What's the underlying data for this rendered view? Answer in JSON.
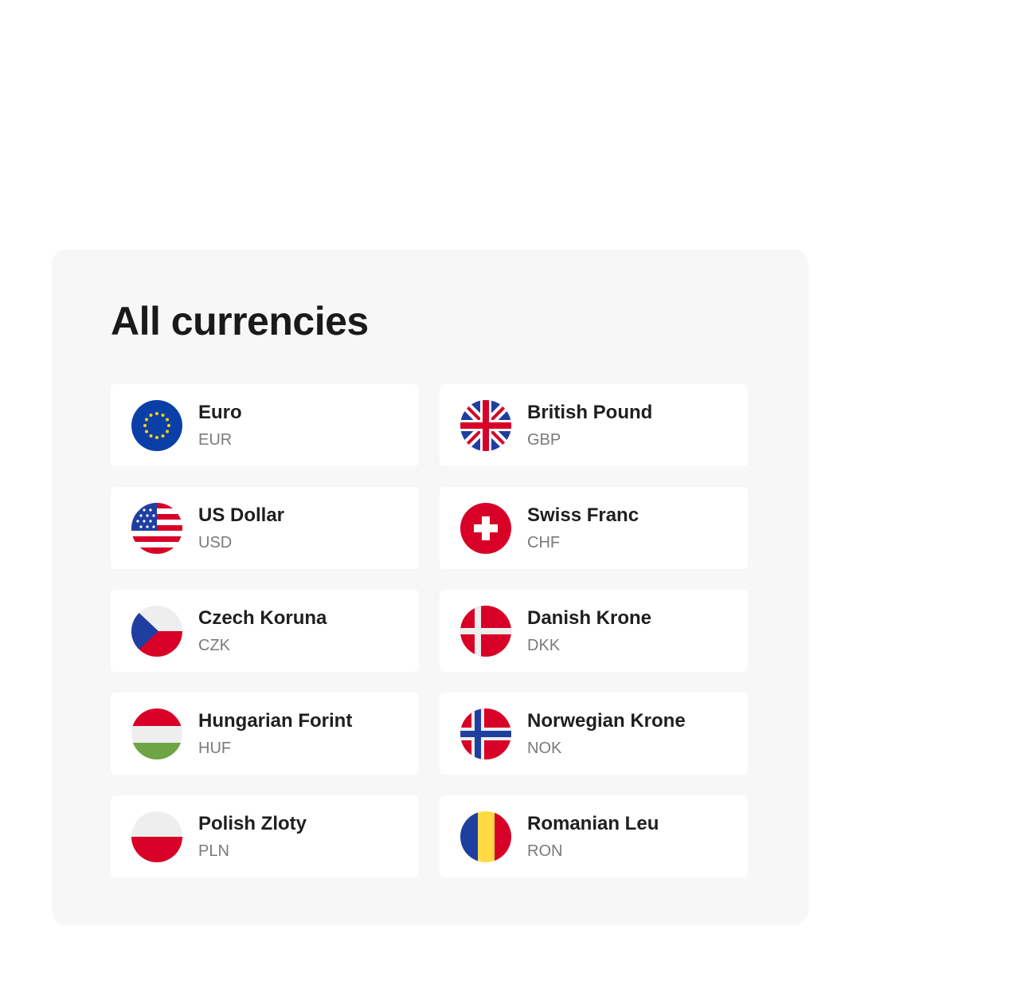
{
  "title": "All currencies",
  "currencies": [
    {
      "name": "Euro",
      "code": "EUR",
      "flag_icon": "eu-flag-icon"
    },
    {
      "name": "British Pound",
      "code": "GBP",
      "flag_icon": "uk-flag-icon"
    },
    {
      "name": "US Dollar",
      "code": "USD",
      "flag_icon": "us-flag-icon"
    },
    {
      "name": "Swiss Franc",
      "code": "CHF",
      "flag_icon": "swiss-flag-icon"
    },
    {
      "name": "Czech Koruna",
      "code": "CZK",
      "flag_icon": "czech-flag-icon"
    },
    {
      "name": "Danish Krone",
      "code": "DKK",
      "flag_icon": "danish-flag-icon"
    },
    {
      "name": "Hungarian Forint",
      "code": "HUF",
      "flag_icon": "hungarian-flag-icon"
    },
    {
      "name": "Norwegian Krone",
      "code": "NOK",
      "flag_icon": "norwegian-flag-icon"
    },
    {
      "name": "Polish Zloty",
      "code": "PLN",
      "flag_icon": "polish-flag-icon"
    },
    {
      "name": "Romanian Leu",
      "code": "RON",
      "flag_icon": "romanian-flag-icon"
    }
  ],
  "colors": {
    "panel_bg": "#f7f7f7",
    "card_bg": "#ffffff",
    "title_text": "#1a1a1a",
    "code_text": "#7a7a7a"
  }
}
